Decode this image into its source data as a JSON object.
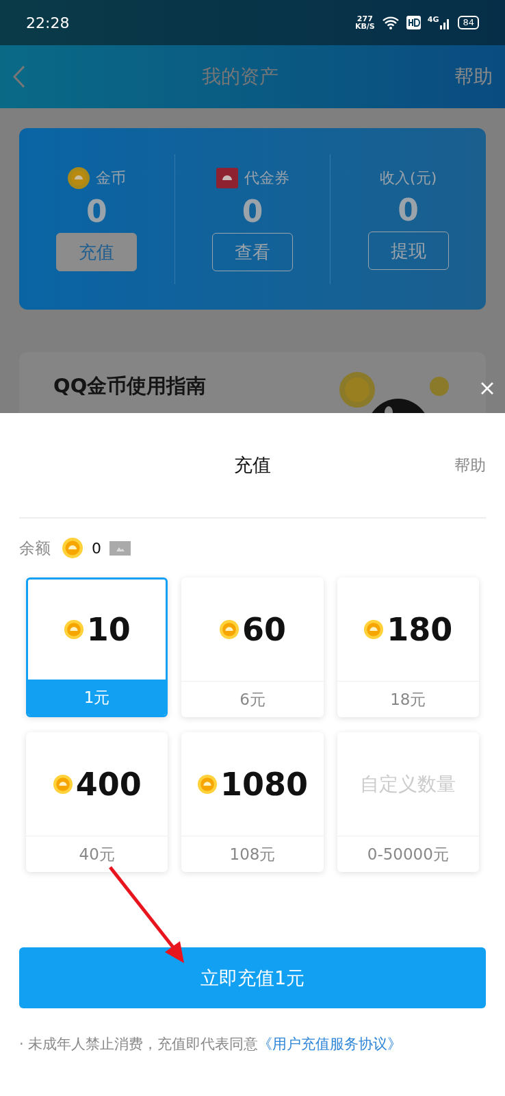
{
  "status_bar": {
    "time": "22:28",
    "speed": "277",
    "speed_unit": "KB/S",
    "network": "4G",
    "battery": "84"
  },
  "nav": {
    "title": "我的资产",
    "help": "帮助"
  },
  "assets": [
    {
      "kind": "coin",
      "label": "金币",
      "value": "0",
      "button": "充值",
      "primary": true
    },
    {
      "kind": "voucher",
      "label": "代金券",
      "value": "0",
      "button": "查看",
      "primary": false
    },
    {
      "kind": "plain",
      "label": "收入(元)",
      "value": "0",
      "button": "提现",
      "primary": false
    }
  ],
  "guide": {
    "title": "QQ金币使用指南"
  },
  "sheet": {
    "title": "充值",
    "help": "帮助",
    "balance_label": "余额",
    "balance": "0",
    "tiers": [
      {
        "kind": "preset",
        "amount": "10",
        "price": "1元",
        "selected": true
      },
      {
        "kind": "preset",
        "amount": "60",
        "price": "6元",
        "selected": false
      },
      {
        "kind": "preset",
        "amount": "180",
        "price": "18元",
        "selected": false
      },
      {
        "kind": "preset",
        "amount": "400",
        "price": "40元",
        "selected": false
      },
      {
        "kind": "preset",
        "amount": "1080",
        "price": "108元",
        "selected": false
      },
      {
        "kind": "custom",
        "amount": "自定义数量",
        "price": "0-50000元",
        "selected": false
      }
    ],
    "pay_button": "立即充值1元",
    "notice": "· 未成年人禁止消费，充值即代表同意",
    "agreement": "《用户充值服务协议》"
  }
}
